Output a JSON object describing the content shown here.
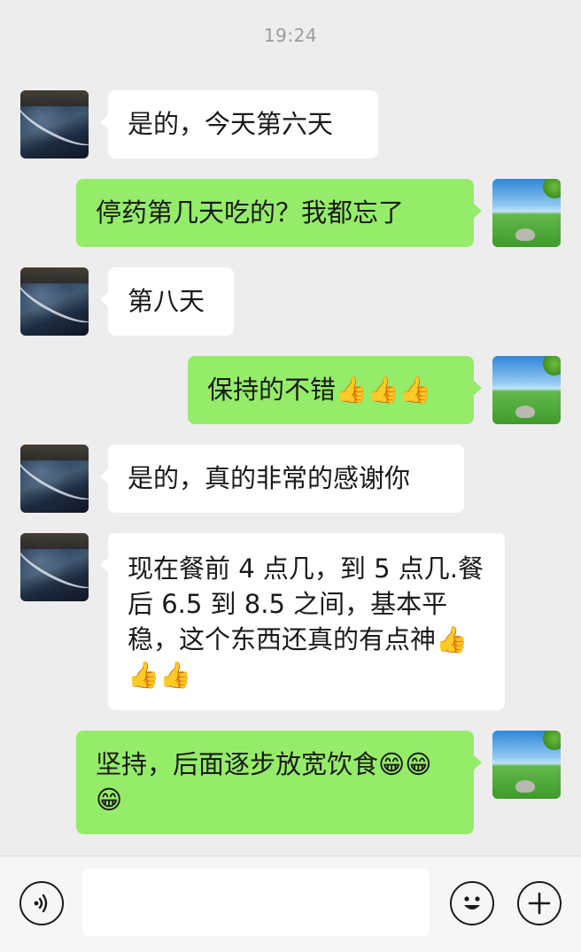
{
  "chat": {
    "timestamp": "19:24",
    "messages": [
      {
        "side": "in",
        "text": "是的，今天第六天"
      },
      {
        "side": "out",
        "text": "停药第几天吃的？我都忘了"
      },
      {
        "side": "in",
        "text": "第八天"
      },
      {
        "side": "out",
        "text": "保持的不错👍👍👍"
      },
      {
        "side": "in",
        "text": "是的，真的非常的感谢你"
      },
      {
        "side": "in",
        "text": "现在餐前 4 点几，到 5 点几.餐后 6.5 到 8.5 之间，基本平稳，这个东西还真的有点神👍👍👍"
      },
      {
        "side": "out",
        "text": "坚持，后面逐步放宽饮食😁😁😁"
      }
    ]
  },
  "input_bar": {
    "voice_icon": "voice-icon",
    "emoji_icon": "emoji-icon",
    "plus_icon": "plus-icon",
    "input_value": ""
  },
  "colors": {
    "background": "#ededed",
    "bubble_in": "#ffffff",
    "bubble_out": "#95ec69"
  }
}
